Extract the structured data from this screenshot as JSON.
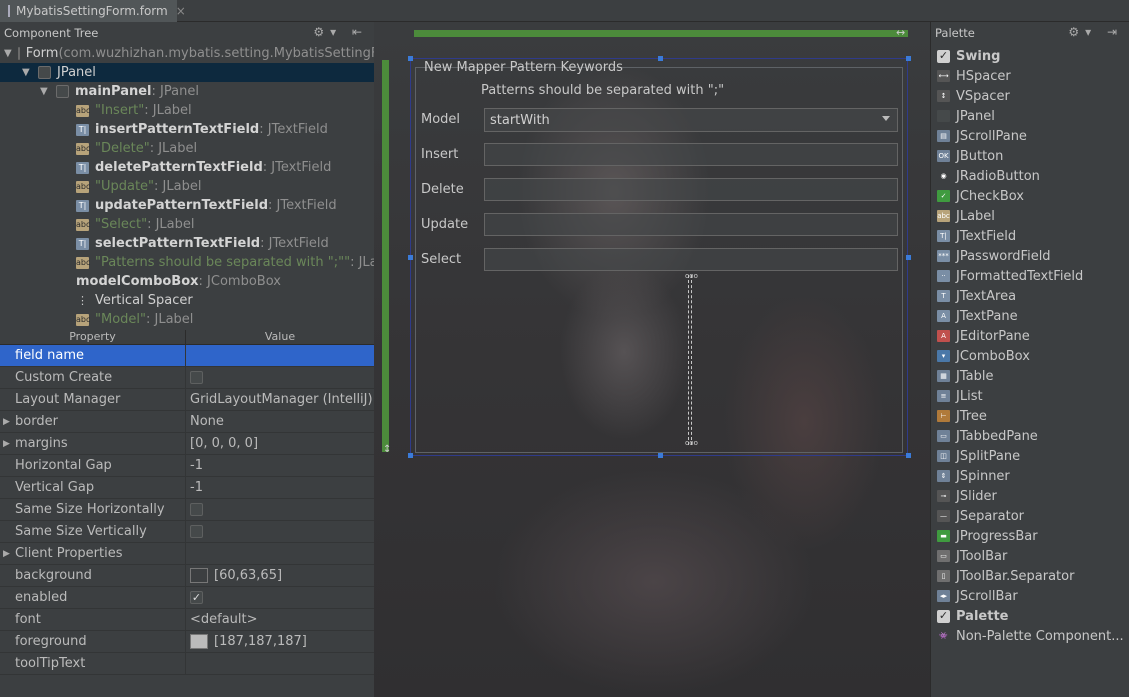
{
  "tab": {
    "label": "MybatisSettingForm.form",
    "close": "×"
  },
  "left": {
    "title": "Component Tree",
    "tools": "⚙▾ ⇤",
    "tree": [
      {
        "indent": 0,
        "tri": "▼",
        "check": true,
        "icon": "",
        "name": "Form",
        "type": " (com.wuzhizhan.mybatis.setting.MybatisSettingForm)",
        "style": "plain"
      },
      {
        "indent": 18,
        "tri": "▼",
        "check": true,
        "icon": "",
        "name": "JPanel",
        "type": "",
        "style": "plain",
        "selected": true
      },
      {
        "indent": 36,
        "tri": "▼",
        "check": true,
        "icon": "",
        "name": "mainPanel",
        "type": " : JPanel",
        "style": "bold"
      },
      {
        "indent": 72,
        "tri": "",
        "check": false,
        "icon": "label",
        "name": "\"Insert\"",
        "type": " : JLabel",
        "style": "str"
      },
      {
        "indent": 72,
        "tri": "",
        "check": false,
        "icon": "field",
        "name": "insertPatternTextField",
        "type": " : JTextField",
        "style": "bold"
      },
      {
        "indent": 72,
        "tri": "",
        "check": false,
        "icon": "label",
        "name": "\"Delete\"",
        "type": " : JLabel",
        "style": "str"
      },
      {
        "indent": 72,
        "tri": "",
        "check": false,
        "icon": "field",
        "name": "deletePatternTextField",
        "type": " : JTextField",
        "style": "bold"
      },
      {
        "indent": 72,
        "tri": "",
        "check": false,
        "icon": "label",
        "name": "\"Update\"",
        "type": " : JLabel",
        "style": "str"
      },
      {
        "indent": 72,
        "tri": "",
        "check": false,
        "icon": "field",
        "name": "updatePatternTextField",
        "type": " : JTextField",
        "style": "bold"
      },
      {
        "indent": 72,
        "tri": "",
        "check": false,
        "icon": "label",
        "name": "\"Select\"",
        "type": " : JLabel",
        "style": "str"
      },
      {
        "indent": 72,
        "tri": "",
        "check": false,
        "icon": "field",
        "name": "selectPatternTextField",
        "type": " : JTextField",
        "style": "bold"
      },
      {
        "indent": 72,
        "tri": "",
        "check": false,
        "icon": "label",
        "name": "\"Patterns should be separated with \";\"\"",
        "type": " : JLabel",
        "style": "str"
      },
      {
        "indent": 72,
        "tri": "",
        "check": false,
        "icon": "combo",
        "name": "modelComboBox",
        "type": " : JComboBox",
        "style": "bold"
      },
      {
        "indent": 72,
        "tri": "",
        "check": false,
        "icon": "spacer",
        "name": "Vertical Spacer",
        "type": "",
        "style": "plainlight"
      },
      {
        "indent": 72,
        "tri": "",
        "check": false,
        "icon": "label",
        "name": "\"Model\"",
        "type": " : JLabel",
        "style": "str"
      }
    ],
    "props_header": {
      "property": "Property",
      "value": "Value"
    },
    "props": [
      {
        "key": "field name",
        "value": "",
        "kind": "text",
        "selected": true
      },
      {
        "key": "Custom Create",
        "value": "",
        "kind": "check"
      },
      {
        "key": "Layout Manager",
        "value": "GridLayoutManager (IntelliJ)",
        "kind": "text"
      },
      {
        "key": "border",
        "value": "None",
        "kind": "text",
        "expand": true
      },
      {
        "key": "margins",
        "value": "[0, 0, 0, 0]",
        "kind": "text",
        "expand": true
      },
      {
        "key": "Horizontal Gap",
        "value": "-1",
        "kind": "text"
      },
      {
        "key": "Vertical Gap",
        "value": "-1",
        "kind": "text"
      },
      {
        "key": "Same Size Horizontally",
        "value": "",
        "kind": "check"
      },
      {
        "key": "Same Size Vertically",
        "value": "",
        "kind": "check"
      },
      {
        "key": "Client Properties",
        "value": "",
        "kind": "text",
        "expand": true
      },
      {
        "key": "background",
        "value": "[60,63,65]",
        "kind": "color",
        "color": "#3c3f41"
      },
      {
        "key": "enabled",
        "value": "✓",
        "kind": "checked"
      },
      {
        "key": "font",
        "value": "<default>",
        "kind": "text"
      },
      {
        "key": "foreground",
        "value": "[187,187,187]",
        "kind": "color",
        "color": "#bbbbbb"
      },
      {
        "key": "toolTipText",
        "value": "",
        "kind": "text"
      }
    ]
  },
  "form": {
    "group_title": "New Mapper Pattern Keywords",
    "hint": "Patterns should be separated with \";\"",
    "model_label": "Model",
    "model_value": "startWith",
    "insert_label": "Insert",
    "delete_label": "Delete",
    "update_label": "Update",
    "select_label": "Select"
  },
  "palette": {
    "title": "Palette",
    "tools": "⚙▾ ⇥",
    "items": [
      {
        "label": "Swing",
        "group": true,
        "icon": ""
      },
      {
        "label": "HSpacer",
        "icon": "hspacer-icon",
        "glyph": "⟷",
        "color": "#555"
      },
      {
        "label": "VSpacer",
        "icon": "vspacer-icon",
        "glyph": "↕",
        "color": "#555"
      },
      {
        "label": "JPanel",
        "icon": "panel-icon",
        "glyph": "",
        "color": "#45494a"
      },
      {
        "label": "JScrollPane",
        "icon": "scrollpane-icon",
        "glyph": "▤",
        "color": "#6f8197"
      },
      {
        "label": "JButton",
        "icon": "button-icon",
        "glyph": "OK",
        "color": "#6f8197"
      },
      {
        "label": "JRadioButton",
        "icon": "radio-icon",
        "glyph": "◉",
        "color": "#3c3f41"
      },
      {
        "label": "JCheckBox",
        "icon": "checkbox-icon",
        "glyph": "✓",
        "color": "#3f9b3f"
      },
      {
        "label": "JLabel",
        "icon": "label-icon",
        "glyph": "abc",
        "color": "#b7a37a"
      },
      {
        "label": "JTextField",
        "icon": "textfield-icon",
        "glyph": "T|",
        "color": "#7a8ea5"
      },
      {
        "label": "JPasswordField",
        "icon": "password-icon",
        "glyph": "***",
        "color": "#7a8ea5"
      },
      {
        "label": "JFormattedTextField",
        "icon": "formatted-icon",
        "glyph": "··",
        "color": "#7a8ea5"
      },
      {
        "label": "JTextArea",
        "icon": "textarea-icon",
        "glyph": "T",
        "color": "#7a8ea5"
      },
      {
        "label": "JTextPane",
        "icon": "textpane-icon",
        "glyph": "A",
        "color": "#7a8ea5"
      },
      {
        "label": "JEditorPane",
        "icon": "editorpane-icon",
        "glyph": "A",
        "color": "#c0504d"
      },
      {
        "label": "JComboBox",
        "icon": "combobox-icon",
        "glyph": "▾",
        "color": "#4a78a8"
      },
      {
        "label": "JTable",
        "icon": "table-icon",
        "glyph": "▦",
        "color": "#6f8197"
      },
      {
        "label": "JList",
        "icon": "list-icon",
        "glyph": "≡",
        "color": "#6f8197"
      },
      {
        "label": "JTree",
        "icon": "tree-icon",
        "glyph": "⊢",
        "color": "#b07a3a"
      },
      {
        "label": "JTabbedPane",
        "icon": "tabbedpane-icon",
        "glyph": "▭",
        "color": "#6f8197"
      },
      {
        "label": "JSplitPane",
        "icon": "splitpane-icon",
        "glyph": "◫",
        "color": "#6f8197"
      },
      {
        "label": "JSpinner",
        "icon": "spinner-icon",
        "glyph": "⇕",
        "color": "#6f8197"
      },
      {
        "label": "JSlider",
        "icon": "slider-icon",
        "glyph": "⊸",
        "color": "#555"
      },
      {
        "label": "JSeparator",
        "icon": "separator-icon",
        "glyph": "—",
        "color": "#555"
      },
      {
        "label": "JProgressBar",
        "icon": "progressbar-icon",
        "glyph": "▬",
        "color": "#3f9b3f"
      },
      {
        "label": "JToolBar",
        "icon": "toolbar-icon",
        "glyph": "▭",
        "color": "#6f6f6f"
      },
      {
        "label": "JToolBar.Separator",
        "icon": "toolbar-separator-icon",
        "glyph": "▯",
        "color": "#6f6f6f"
      },
      {
        "label": "JScrollBar",
        "icon": "scrollbar-icon",
        "glyph": "◂▸",
        "color": "#6f8197"
      },
      {
        "label": "Palette",
        "group": true,
        "icon": ""
      },
      {
        "label": "Non-Palette Component...",
        "icon": "non-palette-icon",
        "glyph": "👾",
        "color": "#3c3f41"
      }
    ]
  }
}
